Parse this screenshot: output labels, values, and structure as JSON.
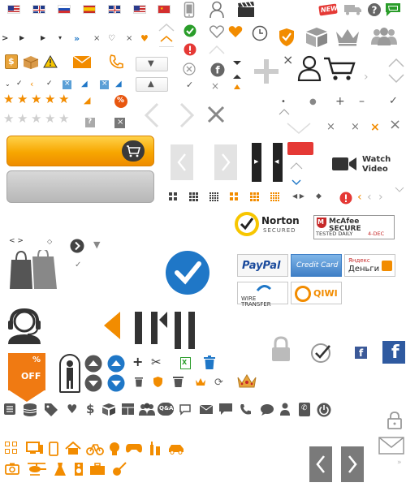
{
  "badges": {
    "new": "NEW",
    "sale_percent": "%",
    "sale_off": "OFF",
    "qa": "Q&A"
  },
  "watch_video": {
    "line1": "Watch",
    "line2": "Video"
  },
  "security": {
    "norton_main": "Norton",
    "norton_sub": "SECURED",
    "mcafee_main": "McAfee SECURE",
    "mcafee_tested": "TESTED DAILY",
    "mcafee_date": "4-DEC"
  },
  "payments": {
    "paypal": "PayPal",
    "credit_card": "Credit Card",
    "yandex_top": "Яндекс",
    "yandex_bottom": "Деньги",
    "wire_transfer": "WIRE TRANSFER",
    "qiwi": "QIWI"
  },
  "colors": {
    "accent_orange": "#f28c00",
    "blue": "#1f77c7",
    "green": "#2a9d2a",
    "red": "#e53935",
    "gray": "#8a8a8a",
    "dark": "#333333"
  },
  "icons": [
    "flag-us-icon",
    "flag-gb-icon",
    "flag-ru-icon",
    "flag-es-icon",
    "flag-gb-icon-2",
    "flag-us-icon-2",
    "flag-cn-icon",
    "mobile-icon",
    "user-icon",
    "clapperboard-icon",
    "new-badge-icon",
    "truck-icon",
    "help-icon",
    "chat-bubble-icon",
    "heart-icon",
    "clock-icon",
    "shield-icon",
    "box-icon",
    "crown-icon",
    "group-icon",
    "cart-icon",
    "star-icon",
    "scissors-icon",
    "trash-icon",
    "lock-icon",
    "facebook-icon",
    "mail-icon",
    "home-icon",
    "camera-icon",
    "helicopter-icon"
  ]
}
